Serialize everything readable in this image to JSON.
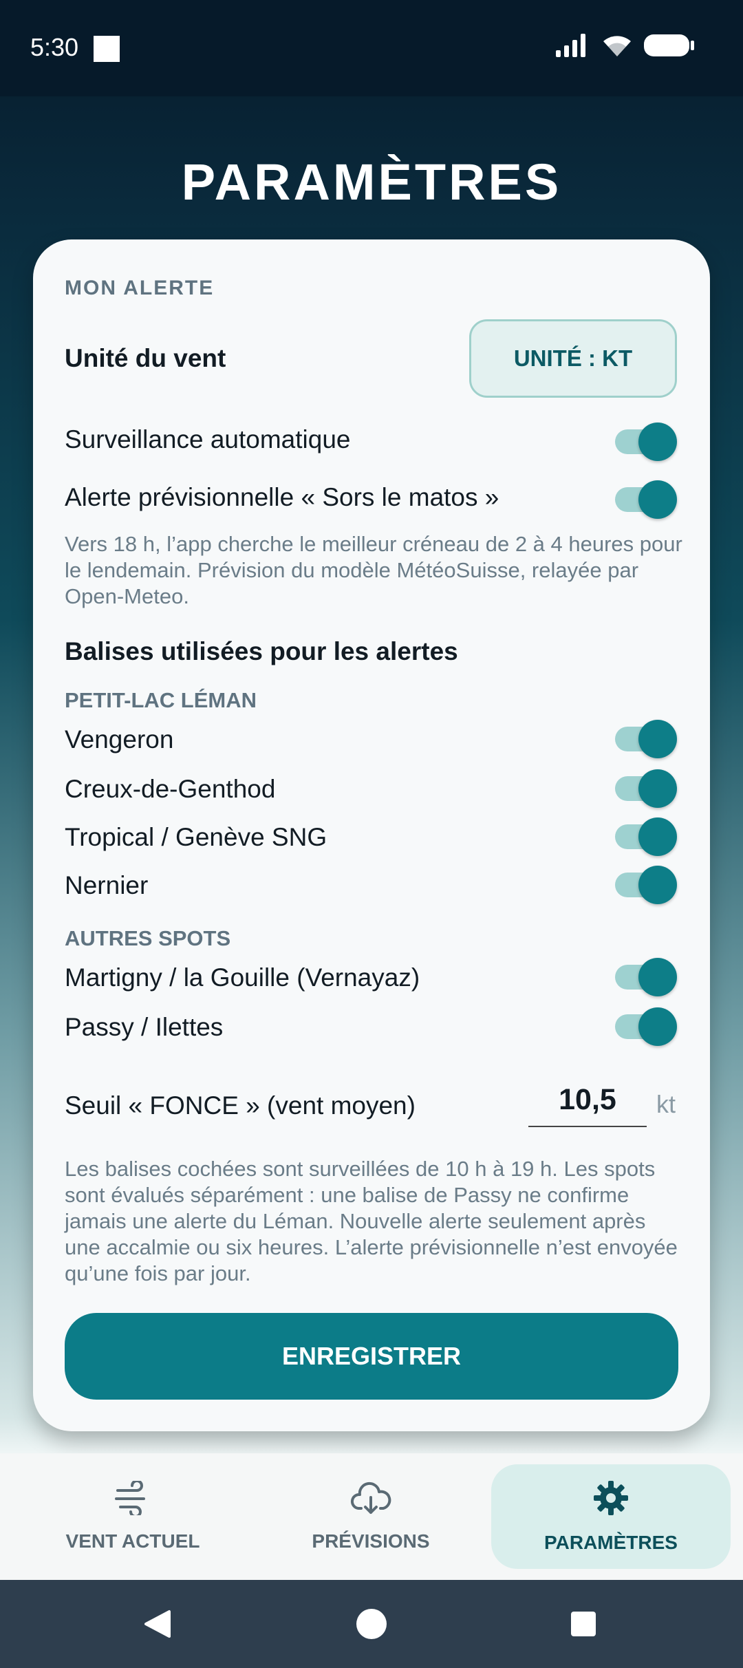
{
  "status": {
    "time": "5:30"
  },
  "page": {
    "title": "PARAMÈTRES"
  },
  "alert": {
    "section_label": "MON ALERTE",
    "wind_unit_label": "Unité du vent",
    "unit_button": "UNITÉ : KT",
    "auto_watch_label": "Surveillance automatique",
    "auto_watch_on": true,
    "forecast_alert_label": "Alerte prévisionnelle « Sors le matos »",
    "forecast_alert_on": true,
    "forecast_desc": "Vers 18 h, l’app cherche le meilleur créneau de 2 à 4 heures pour le lendemain. Prévision du modèle MétéoSuisse, relayée par Open-Meteo.",
    "stations_heading": "Balises utilisées pour les alertes",
    "groups": [
      {
        "label": "PETIT-LAC LÉMAN",
        "stations": [
          {
            "name": "Vengeron",
            "enabled": true
          },
          {
            "name": "Creux-de-Genthod",
            "enabled": true
          },
          {
            "name": "Tropical / Genève SNG",
            "enabled": true
          },
          {
            "name": "Nernier",
            "enabled": true
          }
        ]
      },
      {
        "label": "AUTRES SPOTS",
        "stations": [
          {
            "name": "Martigny / la Gouille (Vernayaz)",
            "enabled": true
          },
          {
            "name": "Passy / Ilettes",
            "enabled": true
          }
        ]
      }
    ],
    "threshold_label": "Seuil « FONCE » (vent moyen)",
    "threshold_value": "10,5",
    "threshold_unit": "kt",
    "info_text": "Les balises cochées sont surveillées de 10 h à 19 h. Les spots sont évalués séparément : une balise de Passy ne confirme jamais une alerte du Léman. Nouvelle alerte seulement après une accalmie ou six heures. L’alerte prévisionnelle n’est envoyée qu’une fois par jour.",
    "save_button": "ENREGISTRER"
  },
  "nav": {
    "items": [
      {
        "label": "VENT ACTUEL",
        "icon": "wind-icon"
      },
      {
        "label": "PRÉVISIONS",
        "icon": "cloud-download-icon"
      },
      {
        "label": "PARAMÈTRES",
        "icon": "gear-icon",
        "active": true
      }
    ]
  },
  "colors": {
    "accent": "#0c7c88",
    "toggle_track": "#9ed1d0",
    "header_bg": "#061a2a"
  }
}
